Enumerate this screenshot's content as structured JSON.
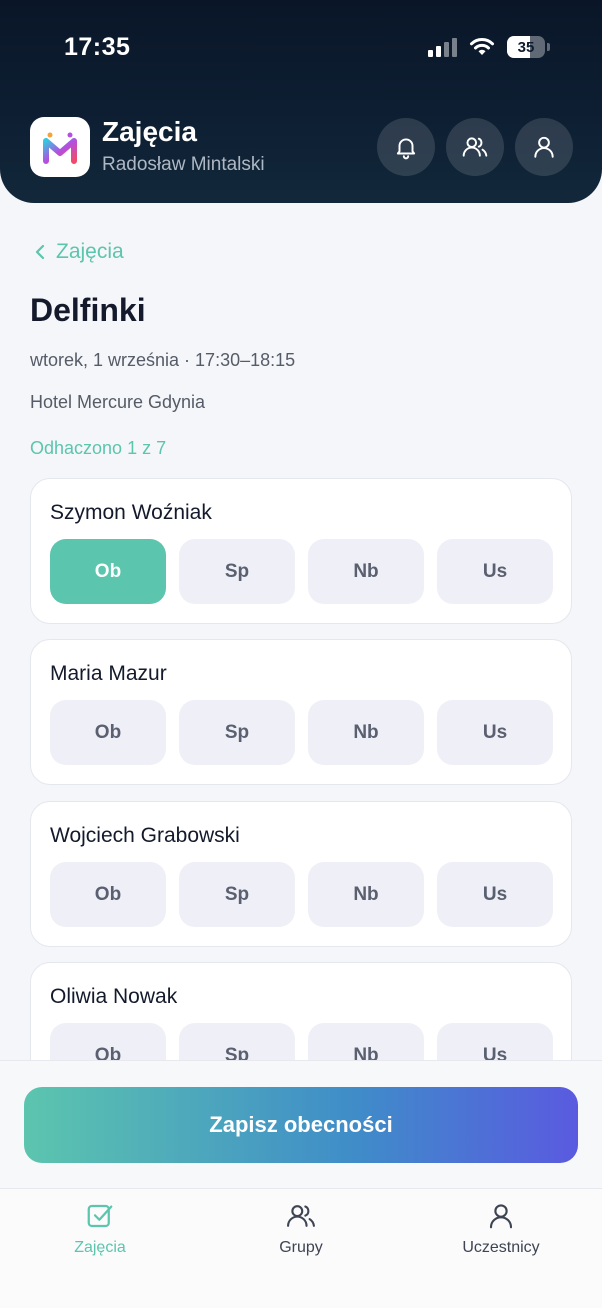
{
  "status_bar": {
    "time": "17:35",
    "battery": "35"
  },
  "header": {
    "title": "Zajęcia",
    "subtitle": "Radosław Mintalski"
  },
  "back": {
    "label": "Zajęcia"
  },
  "session": {
    "group_name": "Delfinki",
    "datetime": "wtorek, 1 września · 17:30–18:15",
    "location": "Hotel Mercure Gdynia",
    "progress": "Odhaczono 1 z 7"
  },
  "participants": [
    {
      "name": "Szymon Woźniak",
      "selected": "Ob"
    },
    {
      "name": "Maria Mazur",
      "selected": ""
    },
    {
      "name": "Wojciech Grabowski",
      "selected": ""
    },
    {
      "name": "Oliwia Nowak",
      "selected": ""
    }
  ],
  "attendance_options": [
    "Ob",
    "Sp",
    "Nb",
    "Us"
  ],
  "save": {
    "label": "Zapisz obecności"
  },
  "nav": [
    {
      "label": "Zajęcia",
      "icon": "checkbox-icon",
      "active": true
    },
    {
      "label": "Grupy",
      "icon": "users-icon",
      "active": false
    },
    {
      "label": "Uczestnicy",
      "icon": "user-icon",
      "active": false
    }
  ],
  "colors": {
    "accent": "#5cc5ae",
    "header_bg": "#0e1f33",
    "option_bg": "#efeff7",
    "gradient_end": "#5a5ae0"
  }
}
